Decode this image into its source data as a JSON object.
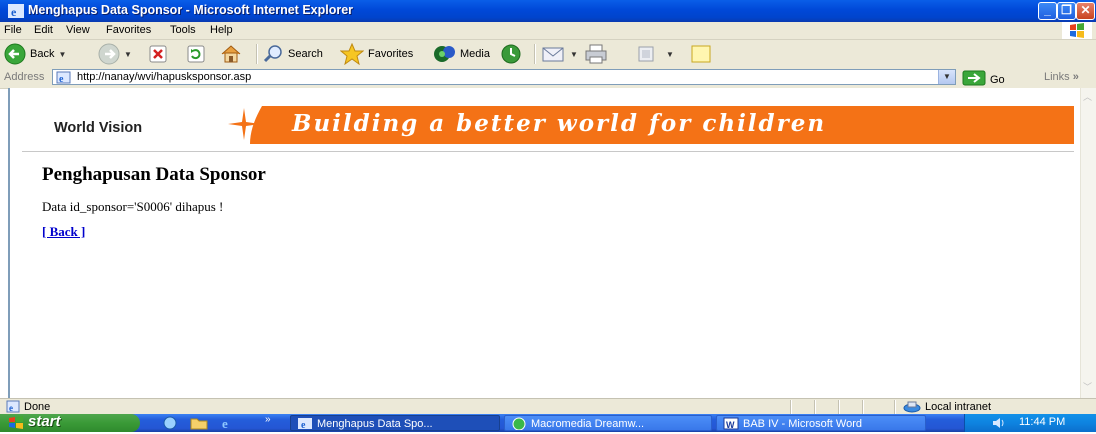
{
  "window": {
    "title": "Menghapus Data Sponsor - Microsoft Internet Explorer",
    "controls": {
      "minimize": "_",
      "maximize": "❐",
      "close": "✕"
    }
  },
  "menu": [
    "File",
    "Edit",
    "View",
    "Favorites",
    "Tools",
    "Help"
  ],
  "toolbar": {
    "back_label": "Back",
    "search_label": "Search",
    "favorites_label": "Favorites",
    "media_label": "Media"
  },
  "address": {
    "label": "Address",
    "url": "http://nanay/wvi/hapusksponsor.asp",
    "go_label": "Go",
    "links_label": "Links"
  },
  "page": {
    "banner_logo_text": "World Vision",
    "banner_slogan": "Building a better world for children",
    "heading": "Penghapusan Data Sponsor",
    "message": "Data id_sponsor='S0006' dihapus !",
    "back_link": "[ Back ]"
  },
  "status": {
    "text": "Done",
    "zone": "Local intranet"
  },
  "taskbar": {
    "start_label": "start",
    "tasks": [
      {
        "label": "Menghapus Data Spo..."
      },
      {
        "label": "Macromedia Dreamw..."
      },
      {
        "label": "BAB IV - Microsoft Word"
      }
    ],
    "clock": "11:44 PM"
  },
  "colors": {
    "titlebar": "#0048d8",
    "banner_orange": "#f47216",
    "link": "#0000cc",
    "chrome": "#ece9d8",
    "start_green": "#3a9a37",
    "taskbar_blue": "#245edb"
  }
}
